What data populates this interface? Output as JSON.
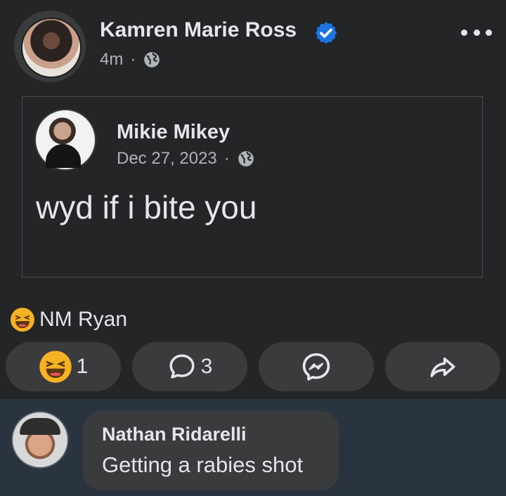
{
  "post": {
    "author": "Kamren Marie Ross",
    "time": "4m",
    "separator": "·",
    "verified_icon": "verified-badge-icon",
    "privacy_icon": "globe-icon",
    "more_icon": "more-options-icon"
  },
  "shared_post": {
    "author": "Mikie Mikey",
    "date": "Dec 27, 2023",
    "separator": "·",
    "privacy_icon": "globe-icon",
    "text": "wyd if i bite you"
  },
  "reactions": {
    "reaction_icon": "haha-emoji-icon",
    "names": "NM Ryan"
  },
  "actions": {
    "reaction_count": "1",
    "comment_count": "3",
    "comment_icon": "comment-icon",
    "messenger_icon": "messenger-icon",
    "share_icon": "share-icon"
  },
  "comment": {
    "author": "Nathan Ridarelli",
    "text": "Getting a rabies shot"
  },
  "colors": {
    "background": "#242526",
    "surface": "#3a3b3c",
    "comment_area": "#2a3441",
    "verified": "#1b74e4",
    "text_primary": "#e4e6eb",
    "text_secondary": "#b0b3b8"
  }
}
